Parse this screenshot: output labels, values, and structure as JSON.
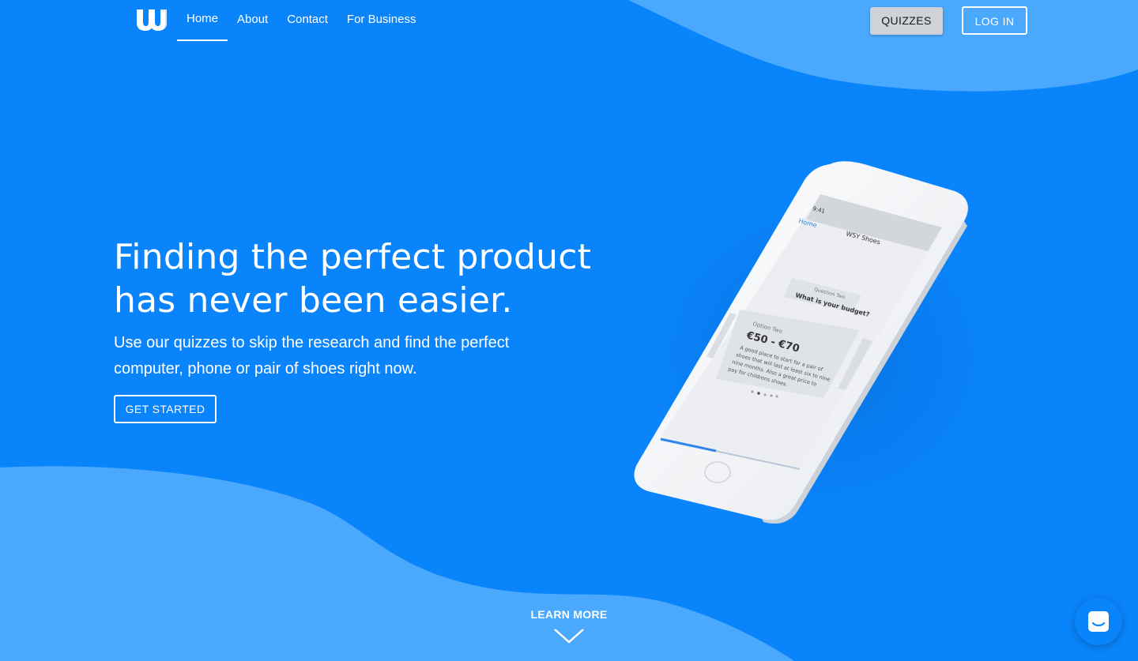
{
  "nav": {
    "logo": "w-logo-icon",
    "links": [
      {
        "label": "Home",
        "active": true
      },
      {
        "label": "About",
        "active": false
      },
      {
        "label": "Contact",
        "active": false
      },
      {
        "label": "For Business",
        "active": false
      }
    ],
    "quizzes_label": "QUIZZES",
    "login_label": "LOG IN"
  },
  "hero": {
    "title_lines": [
      "Finding the perfect product",
      "has never been easier."
    ],
    "subtitle_lines": [
      "Use our quizzes to skip the research and find the perfect",
      "computer, phone or pair of shoes right now."
    ],
    "cta_label": "GET STARTED"
  },
  "phone_screen": {
    "time": "9:41",
    "back_label": "Home",
    "screen_title": "WSY Shoes",
    "question_label": "Question Two",
    "question_text": "What is your budget?",
    "option_label": "Option Two",
    "option_price": "€50 - €70",
    "option_desc_lines": [
      "A good place to start for a pair of",
      "shoes that will last at least six to nine",
      "nine months. Also a great price to",
      "pay for childrens shoes."
    ]
  },
  "learn_more_label": "LEARN MORE",
  "colors": {
    "background": "#0a84fb",
    "blob": "#4aa8fd",
    "quizzes_button": "#cfd2d6"
  },
  "icons": [
    "w-logo-icon",
    "chevron-down-icon",
    "chat-icon"
  ]
}
